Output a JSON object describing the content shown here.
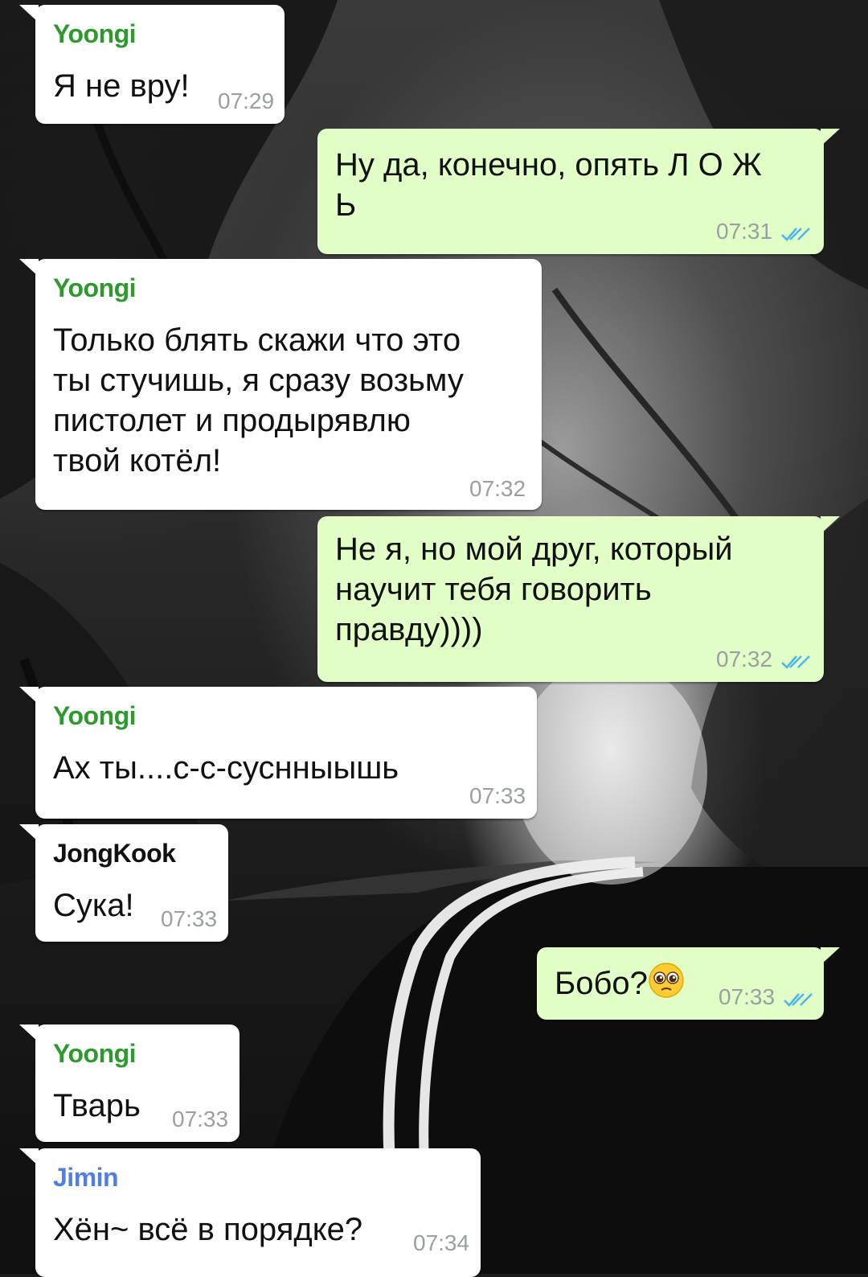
{
  "colors": {
    "incoming_bubble": "#ffffff",
    "outgoing_bubble": "#e2ffc7",
    "timestamp": "#9aa0a0",
    "read_ticks": "#4fb6ec",
    "yoongi_name": "#2e9a2e",
    "jongkook_name": "#111111",
    "jimin_name": "#4f7fe0"
  },
  "messages": [
    {
      "sender": "Yoongi",
      "text": "Я не вру!",
      "time": "07:29"
    },
    {
      "text": "Ну да, конечно, опять Л О Ж\nЬ",
      "time": "07:31",
      "status_icon": "double-check-read"
    },
    {
      "sender": "Yoongi",
      "text": "Только блять скажи что это\nты стучишь, я сразу возьму\nпистолет и продырявлю\nтвой котёл!",
      "time": "07:32"
    },
    {
      "text": "Не я, но мой друг, который\nнаучит тебя говорить\nправду))))",
      "time": "07:32",
      "status_icon": "double-check-read"
    },
    {
      "sender": "Yoongi",
      "text": "Ах ты....с-с-суснныышь",
      "time": "07:33"
    },
    {
      "sender": "JongKook",
      "text": "Сука!",
      "time": "07:33"
    },
    {
      "text": "Бобо?",
      "emoji": "pleading-face",
      "time": "07:33",
      "status_icon": "double-check-read"
    },
    {
      "sender": "Yoongi",
      "text": "Тварь",
      "time": "07:33"
    },
    {
      "sender": "Jimin",
      "text": "Хён~ всё в порядке?",
      "time": "07:34"
    }
  ]
}
